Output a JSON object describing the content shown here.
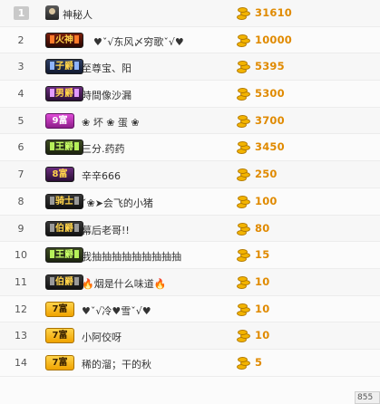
{
  "ranking": [
    {
      "rank": "1",
      "name": "神秘人",
      "score": "31610",
      "badge": null,
      "avatar": true
    },
    {
      "rank": "2",
      "name": "♥ˇ√东风〆穷歌ˇ√♥",
      "score": "10000",
      "badge": {
        "label": "火神",
        "style": "b-fire"
      }
    },
    {
      "rank": "3",
      "name": "至尊宝、阳",
      "score": "5395",
      "badge": {
        "label": "子爵",
        "style": "b-navy"
      }
    },
    {
      "rank": "4",
      "name": "時間像沙漏",
      "score": "5300",
      "badge": {
        "label": "男爵",
        "style": "b-purple"
      }
    },
    {
      "rank": "5",
      "name": "❀ 坏 ❀ 蛋 ❀",
      "score": "3700",
      "badge": {
        "label": "9富",
        "style": "b-magenta"
      }
    },
    {
      "rank": "6",
      "name": "三分.药药",
      "score": "3450",
      "badge": {
        "label": "王爵",
        "style": "b-green"
      }
    },
    {
      "rank": "7",
      "name": "辛辛666",
      "score": "250",
      "badge": {
        "label": "8富",
        "style": "b-purple"
      }
    },
    {
      "rank": "8",
      "name": "ˇ❀➤会飞的小猪",
      "score": "100",
      "badge": {
        "label": "骑士",
        "style": "b-dark"
      }
    },
    {
      "rank": "9",
      "name": "幕后老哥!!",
      "score": "80",
      "badge": {
        "label": "伯爵",
        "style": "b-dark"
      }
    },
    {
      "rank": "10",
      "name": "我抽抽抽抽抽抽抽抽抽",
      "score": "15",
      "badge": {
        "label": "王爵",
        "style": "b-green"
      }
    },
    {
      "rank": "11",
      "name": "🔥烟是什么味道🔥",
      "score": "10",
      "badge": {
        "label": "伯爵",
        "style": "b-dark"
      }
    },
    {
      "rank": "12",
      "name": "♥ˇ√冷♥雪ˇ√♥",
      "score": "10",
      "badge": {
        "label": "7富",
        "style": "b-gold"
      }
    },
    {
      "rank": "13",
      "name": "小阿佼呀",
      "score": "10",
      "badge": {
        "label": "7富",
        "style": "b-gold"
      }
    },
    {
      "rank": "14",
      "name": "稀的溜；干的秋",
      "score": "5",
      "badge": {
        "label": "7富",
        "style": "b-gold"
      }
    }
  ],
  "scroll_indicator": "855"
}
